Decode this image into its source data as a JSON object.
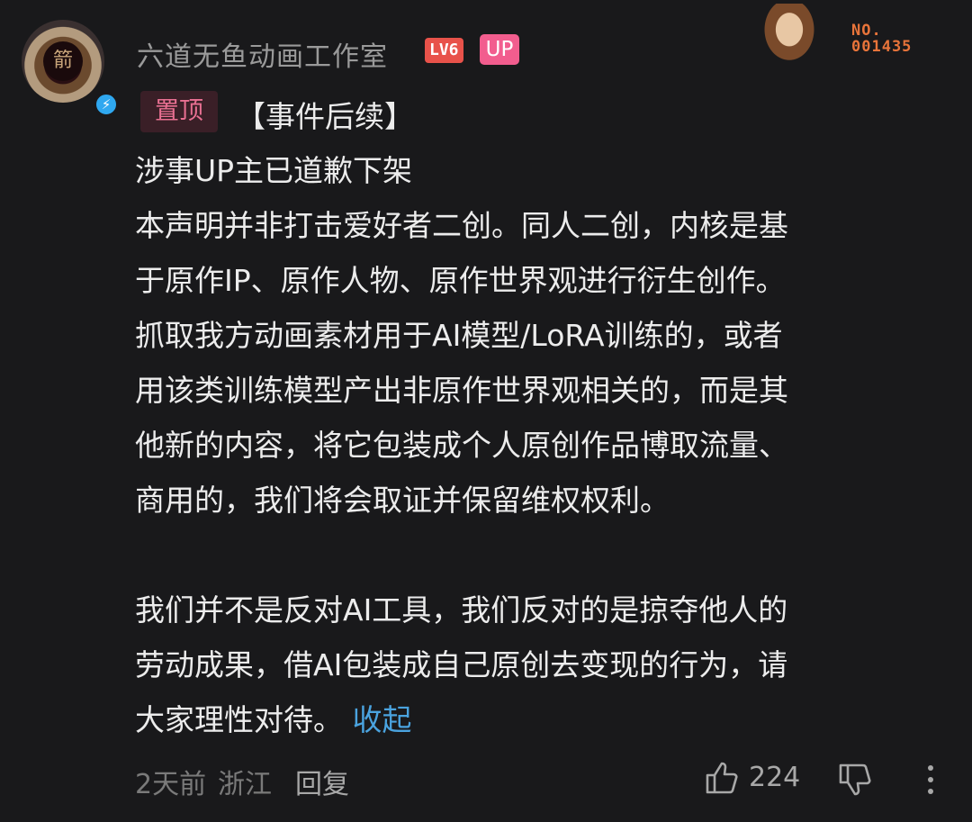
{
  "comment": {
    "author": "六道无鱼动画工作室",
    "level": "LV6",
    "up_badge": "UP",
    "decoration_label": "NO.",
    "decoration_number": "001435",
    "pin_label": "置顶",
    "lines": [
      "【事件后续】",
      "涉事UP主已道歉下架",
      "本声明并非打击爱好者二创。同人二创，内核是基",
      "于原作IP、原作人物、原作世界观进行衍生创作。",
      "抓取我方动画素材用于AI模型/LoRA训练的，或者",
      "用该类训练模型产出非原作世界观相关的，而是其",
      "他新的内容，将它包装成个人原创作品博取流量、",
      "商用的，我们将会取证并保留维权权利。",
      "我们并不是反对AI工具，我们反对的是掠夺他人的",
      "劳动成果，借AI包装成自己原创去变现的行为，请",
      "大家理性对待。"
    ],
    "collapse_label": "收起",
    "time": "2天前",
    "location": "浙江",
    "reply_label": "回复",
    "like_count": "224",
    "emblem_char": "箭"
  },
  "icons": {
    "verified": "lightning-verified-icon",
    "like": "thumbs-up-icon",
    "dislike": "thumbs-down-icon",
    "more": "more-vertical-icon"
  },
  "colors": {
    "background": "#19191b",
    "level_badge": "#e8524a",
    "up_badge": "#f25d8e",
    "link": "#4aa3df"
  }
}
